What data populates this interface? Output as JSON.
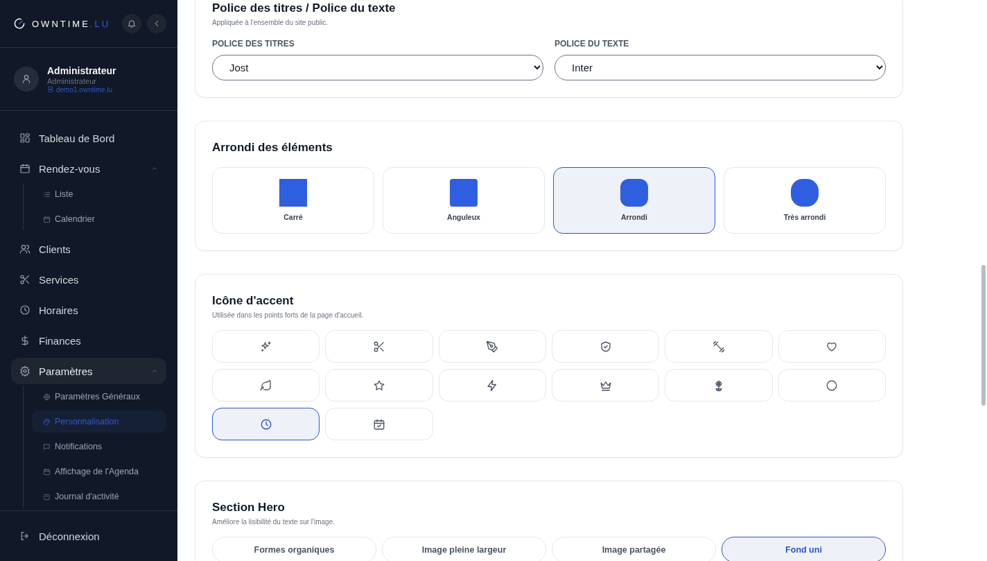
{
  "sidebar": {
    "logo": {
      "name": "OWNTIME",
      "suffix": ".LU"
    },
    "user": {
      "name": "Administrateur",
      "role": "Administrateur",
      "site": "demo1.owntime.lu"
    },
    "nav": [
      {
        "label": "Tableau de Bord",
        "selected": false
      },
      {
        "label": "Rendez-vous",
        "selected": false,
        "expanded": true,
        "children": [
          {
            "label": "Liste",
            "selected": false
          },
          {
            "label": "Calendrier",
            "selected": false
          }
        ]
      },
      {
        "label": "Clients",
        "selected": false
      },
      {
        "label": "Services",
        "selected": false
      },
      {
        "label": "Horaires",
        "selected": false
      },
      {
        "label": "Finances",
        "selected": false
      },
      {
        "label": "Paramètres",
        "selected": true,
        "expanded": true,
        "children": [
          {
            "label": "Paramètres Généraux",
            "selected": false
          },
          {
            "label": "Personnalisation",
            "selected": true
          },
          {
            "label": "Notifications",
            "selected": false
          },
          {
            "label": "Affichage de l'Agenda",
            "selected": false
          },
          {
            "label": "Journal d'activité",
            "selected": false
          }
        ]
      }
    ],
    "logout": "Déconnexion"
  },
  "fonts": {
    "title": "Police des titres / Police du texte",
    "subtitle": "Appliquée à l'ensemble du site public.",
    "fields": [
      {
        "label": "POLICE DES TITRES",
        "value": "Jost"
      },
      {
        "label": "POLICE DU TEXTE",
        "value": "Inter"
      }
    ]
  },
  "rounding": {
    "title": "Arrondi des éléments",
    "options": [
      {
        "label": "Carré",
        "selected": false
      },
      {
        "label": "Anguleux",
        "selected": false
      },
      {
        "label": "Arrondi",
        "selected": true
      },
      {
        "label": "Très arrondi",
        "selected": false
      }
    ]
  },
  "accent_icon": {
    "title": "Icône d'accent",
    "subtitle": "Utilisée dans les points forts de la page d'accueil.",
    "options": [
      {
        "selected": false
      },
      {
        "selected": false
      },
      {
        "selected": false
      },
      {
        "selected": false
      },
      {
        "selected": false
      },
      {
        "selected": false
      },
      {
        "selected": false
      },
      {
        "selected": false
      },
      {
        "selected": false
      },
      {
        "selected": false
      },
      {
        "selected": false
      },
      {
        "selected": false
      },
      {
        "selected": true
      },
      {
        "selected": false
      }
    ]
  },
  "hero": {
    "title": "Section Hero",
    "subtitle": "Améliore la lisibilité du texte sur l'image.",
    "options": [
      {
        "label": "Formes organiques",
        "selected": false
      },
      {
        "label": "Image pleine largeur",
        "selected": false
      },
      {
        "label": "Image partagée",
        "selected": false
      },
      {
        "label": "Fond uni",
        "selected": true
      }
    ]
  }
}
